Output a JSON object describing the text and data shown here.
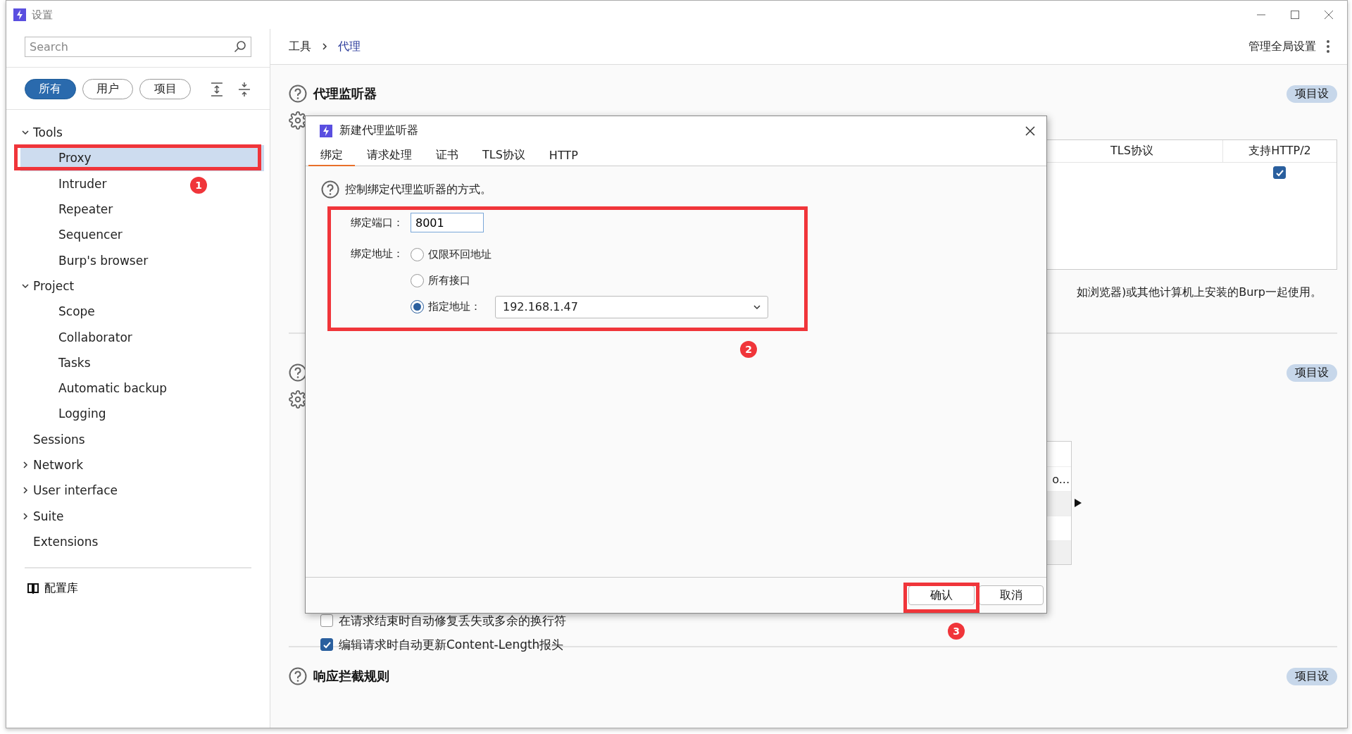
{
  "window": {
    "title": "设置"
  },
  "sidebar": {
    "search": {
      "placeholder": "Search"
    },
    "filters": [
      {
        "label": "所有",
        "selected": true
      },
      {
        "label": "用户",
        "selected": false
      },
      {
        "label": "项目",
        "selected": false
      }
    ],
    "tree": [
      {
        "label": "Tools",
        "expanded": true,
        "selected": false,
        "children": [
          {
            "label": "Proxy",
            "selected": true
          },
          {
            "label": "Intruder",
            "selected": false
          },
          {
            "label": "Repeater",
            "selected": false
          },
          {
            "label": "Sequencer",
            "selected": false
          },
          {
            "label": "Burp's browser",
            "selected": false
          }
        ]
      },
      {
        "label": "Project",
        "expanded": true,
        "selected": false,
        "children": [
          {
            "label": "Scope",
            "selected": false
          },
          {
            "label": "Collaborator",
            "selected": false
          },
          {
            "label": "Tasks",
            "selected": false
          },
          {
            "label": "Automatic backup",
            "selected": false
          },
          {
            "label": "Logging",
            "selected": false
          }
        ]
      },
      {
        "label": "Sessions",
        "selected": false
      },
      {
        "label": "Network",
        "expanded": false,
        "selected": false
      },
      {
        "label": "User interface",
        "expanded": false,
        "selected": false
      },
      {
        "label": "Suite",
        "expanded": false,
        "selected": false
      },
      {
        "label": "Extensions",
        "selected": false
      }
    ],
    "library": "配置库"
  },
  "breadcrumb": [
    {
      "label": "工具",
      "selected": false
    },
    {
      "label": "代理",
      "selected": true
    }
  ],
  "global_settings": "管理全局设置",
  "sections": [
    {
      "title": "代理监听器",
      "badge": "项目设",
      "table": {
        "columns": [
          "TLS协议",
          "支持HTTP/2"
        ],
        "rows": [
          {
            "http2": true
          }
        ]
      },
      "note": "如浏览器)或其他计算机上安装的Burp一起使用。"
    },
    {
      "badge": "项目设",
      "table": {
        "cell": "o..."
      },
      "options": [
        {
          "label": "在请求结束时自动修复丢失或多余的换行符",
          "checked": false
        },
        {
          "label": "编辑请求时自动更新Content-Length报头",
          "checked": true
        }
      ]
    },
    {
      "title": "响应拦截规则",
      "badge": "项目设"
    }
  ],
  "dialog": {
    "title": "新建代理监听器",
    "tabs": [
      {
        "label": "绑定",
        "selected": true
      },
      {
        "label": "请求处理",
        "selected": false
      },
      {
        "label": "证书",
        "selected": false
      },
      {
        "label": "TLS协议",
        "selected": false
      },
      {
        "label": "HTTP",
        "selected": false
      }
    ],
    "hint": "控制绑定代理监听器的方式。",
    "port": {
      "label": "绑定端口：",
      "value": "8001"
    },
    "address": {
      "label": "绑定地址：",
      "options": [
        {
          "label": "仅限环回地址",
          "selected": false
        },
        {
          "label": "所有接口",
          "selected": false
        },
        {
          "label": "指定地址：",
          "selected": true,
          "value": "192.168.1.47"
        }
      ]
    },
    "buttons": [
      "确认",
      "取消"
    ]
  },
  "annotations": [
    {
      "label": "1"
    },
    {
      "label": "2"
    },
    {
      "label": "3"
    }
  ]
}
